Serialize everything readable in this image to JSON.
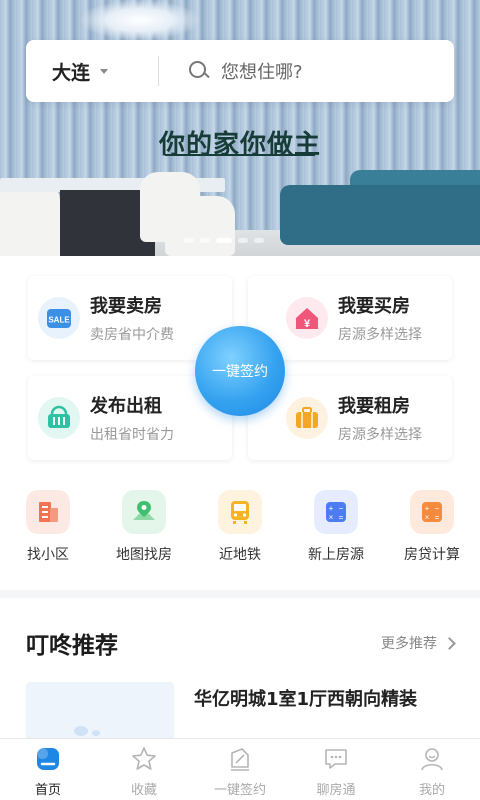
{
  "banner": {
    "slogan": "你的家你做主",
    "dots_total": 5,
    "active_dot": 2
  },
  "search": {
    "city": "大连",
    "placeholder": "您想住哪?"
  },
  "services": [
    {
      "title": "我要卖房",
      "subtitle": "卖房省中介费",
      "icon": "sale-tag-icon",
      "color": "#3d8fe6"
    },
    {
      "title": "我要买房",
      "subtitle": "房源多样选择",
      "icon": "yuan-house-icon",
      "color": "#f0557a"
    },
    {
      "title": "发布出租",
      "subtitle": "出租省时省力",
      "icon": "rent-basket-icon",
      "color": "#2fc1a4"
    },
    {
      "title": "我要租房",
      "subtitle": "房源多样选择",
      "icon": "suitcase-icon",
      "color": "#f5a623"
    }
  ],
  "sign_button": {
    "label": "一键签约"
  },
  "shortcuts": [
    {
      "label": "找小区",
      "icon": "community-icon",
      "color": "#f07453"
    },
    {
      "label": "地图找房",
      "icon": "map-pin-icon",
      "color": "#3fbf6f"
    },
    {
      "label": "近地铁",
      "icon": "subway-icon",
      "color": "#f5b325"
    },
    {
      "label": "新上房源",
      "icon": "calculator-blue-icon",
      "color": "#4d7cf2"
    },
    {
      "label": "房贷计算",
      "icon": "calculator-orange-icon",
      "color": "#f38a3c"
    }
  ],
  "recommend": {
    "title": "叮咚推荐",
    "more": "更多推荐",
    "items": [
      {
        "name": "华亿明城1室1厅西朝向精装"
      }
    ]
  },
  "tabs": [
    {
      "label": "首页",
      "icon": "home-icon",
      "active": true
    },
    {
      "label": "收藏",
      "icon": "star-icon",
      "active": false
    },
    {
      "label": "一键签约",
      "icon": "sign-pen-icon",
      "active": false
    },
    {
      "label": "聊房通",
      "icon": "chat-icon",
      "active": false
    },
    {
      "label": "我的",
      "icon": "profile-icon",
      "active": false
    }
  ],
  "colors": {
    "accent": "#1e86e3",
    "tab_active": "#222222",
    "tab_inactive": "#aaaaaa"
  }
}
